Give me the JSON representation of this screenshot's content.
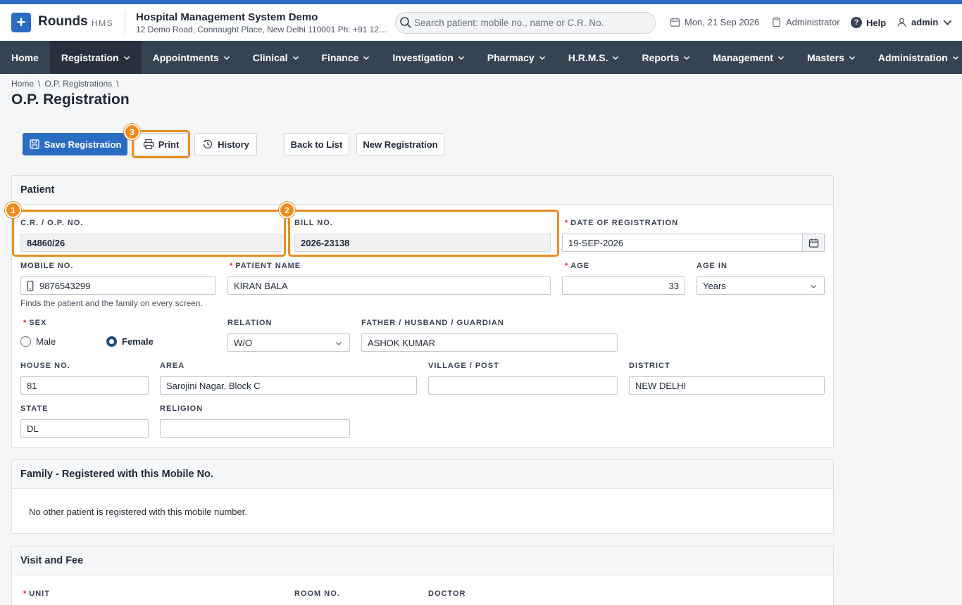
{
  "header": {
    "logo_glyph": "+",
    "brand": "Rounds",
    "brand_sub": "HMS",
    "org_title": "Hospital Management System Demo",
    "org_address": "12 Demo Road, Connaught Place, New Delhi 110001 Ph: +91 123...",
    "search_placeholder": "Search patient: mobile no., name or C.R. No.",
    "date": "Mon, 21 Sep 2026",
    "role": "Administrator",
    "help": "Help",
    "user": "admin"
  },
  "nav": [
    {
      "label": "Home",
      "caret": false,
      "active": false
    },
    {
      "label": "Registration",
      "caret": true,
      "active": true
    },
    {
      "label": "Appointments",
      "caret": true,
      "active": false
    },
    {
      "label": "Clinical",
      "caret": true,
      "active": false
    },
    {
      "label": "Finance",
      "caret": true,
      "active": false
    },
    {
      "label": "Investigation",
      "caret": true,
      "active": false
    },
    {
      "label": "Pharmacy",
      "caret": true,
      "active": false
    },
    {
      "label": "H.R.M.S.",
      "caret": true,
      "active": false
    },
    {
      "label": "Reports",
      "caret": true,
      "active": false
    },
    {
      "label": "Management",
      "caret": true,
      "active": false
    },
    {
      "label": "Masters",
      "caret": true,
      "active": false
    },
    {
      "label": "Administration",
      "caret": true,
      "active": false
    }
  ],
  "breadcrumb": {
    "home": "Home",
    "sep": "\\",
    "section": "O.P. Registrations"
  },
  "page_title": "O.P. Registration",
  "toolbar": {
    "save": "Save Registration",
    "print": "Print",
    "history": "History",
    "back": "Back to List",
    "new": "New Registration"
  },
  "markers": {
    "m1": "1",
    "m2": "2",
    "m3": "3"
  },
  "patient_card": {
    "title": "Patient",
    "cr_label": "C.R. / O.P. No.",
    "cr_value": "84860/26",
    "bill_label": "Bill No.",
    "bill_value": "2026-23138",
    "date_label": "Date of Registration",
    "date_value": "19-SEP-2026",
    "mobile_label": "Mobile No.",
    "mobile_value": "9876543299",
    "mobile_help": "Finds the patient and the family on every screen.",
    "name_label": "Patient Name",
    "name_value": "KIRAN BALA",
    "age_label": "Age",
    "age_value": "33",
    "age_in_label": "Age In",
    "age_in_value": "Years",
    "sex_label": "Sex",
    "sex_male": "Male",
    "sex_female": "Female",
    "relation_label": "Relation",
    "relation_value": "W/O",
    "guardian_label": "Father / Husband / Guardian",
    "guardian_value": "ASHOK KUMAR",
    "house_label": "House No.",
    "house_value": "81",
    "area_label": "Area",
    "area_value": "Sarojini Nagar, Block C",
    "village_label": "Village / Post",
    "village_value": "",
    "district_label": "District",
    "district_value": "NEW DELHI",
    "state_label": "State",
    "state_value": "DL",
    "religion_label": "Religion",
    "religion_value": ""
  },
  "family_card": {
    "title": "Family - Registered with this Mobile No.",
    "message": "No other patient is registered with this mobile number."
  },
  "visit_card": {
    "title": "Visit and Fee",
    "unit_label": "Unit",
    "room_label": "Room No.",
    "doctor_label": "Doctor"
  },
  "colors": {
    "brand": "#2a6cc1",
    "nav": "#364352",
    "highlight": "#ee8d1f"
  }
}
